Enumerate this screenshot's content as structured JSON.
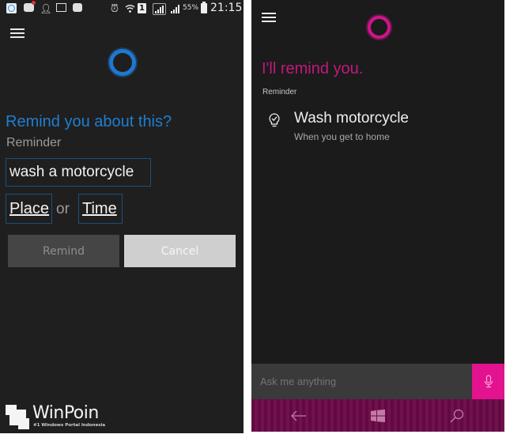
{
  "left_screen": {
    "status_bar": {
      "icons": [
        "cortana-icon",
        "bbm-notification-icon",
        "person-add-icon",
        "gallery-icon",
        "bbm-icon",
        "alarm-icon",
        "wifi-icon",
        "sim-1-icon",
        "signal-icon",
        "signal-icon"
      ],
      "sim_label": "1",
      "battery_percent": "55%",
      "time": "21:15"
    },
    "question_title": "Remind you about this?",
    "reminder_label": "Reminder",
    "reminder_value": "wash a motorcycle",
    "choice_place": "Place",
    "or_text": "or",
    "choice_time": "Time",
    "remind_button": "Remind",
    "cancel_button": "Cancel",
    "watermark": {
      "brand": "WinPoin",
      "tagline": "#1 Windows Portal Indonesia"
    },
    "accent_color": "#1e7fd0"
  },
  "right_screen": {
    "confirmation_title": "I'll remind you.",
    "reminder_label": "Reminder",
    "reminder_item": {
      "icon": "lightbulb-check-icon",
      "title": "Wash motorcycle",
      "condition": "When you get to home"
    },
    "ask_placeholder": "Ask me anything",
    "nav": {
      "back": "back-arrow-icon",
      "home": "windows-logo-icon",
      "search": "search-icon"
    },
    "accent_color": "#e3128f"
  }
}
